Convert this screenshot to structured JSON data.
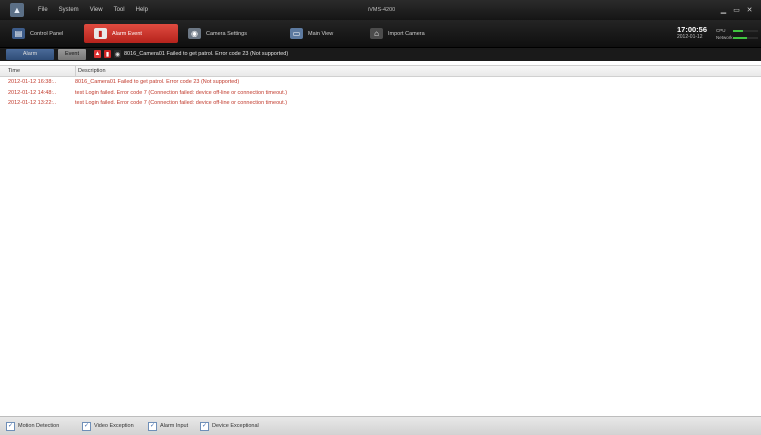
{
  "window": {
    "title": "iVMS-4200",
    "menu": [
      "File",
      "System",
      "View",
      "Tool",
      "Help"
    ],
    "controls": [
      "▁",
      "▭",
      "✕"
    ]
  },
  "toolbar": {
    "tabs": [
      {
        "label": "Control Panel",
        "icon": "control-panel-icon",
        "active": false
      },
      {
        "label": "Alarm Event",
        "icon": "alarm-event-icon",
        "active": true
      },
      {
        "label": "Camera Settings",
        "icon": "camera-settings-icon",
        "active": false
      },
      {
        "label": "Main View",
        "icon": "main-view-icon",
        "active": false
      },
      {
        "label": "Import Camera",
        "icon": "import-camera-icon",
        "active": false
      }
    ],
    "time": "17:00:56",
    "date": "2012-01-12",
    "meters": [
      {
        "label": "CPU",
        "level": 0.4
      },
      {
        "label": "Network",
        "level": 0.55
      }
    ]
  },
  "subbar": {
    "tabs": [
      "Alarm",
      "Event"
    ],
    "active": "Event",
    "message": "8016_Camera01 Failed to get patrol. Error code 23 (Not supported)"
  },
  "table": {
    "headers": [
      "Time",
      "Description"
    ],
    "rows": [
      {
        "time": "2012-01-12 16:38:..",
        "description": "8016_Camera01 Failed to get patrol. Error code 23 (Not supported)"
      },
      {
        "time": "2012-01-12 14:48:..",
        "description": "test Login failed. Error code 7 (Connection failed: device off-line or connection timeout.)"
      },
      {
        "time": "2012-01-12 13:22:..",
        "description": "test Login failed. Error code 7 (Connection failed: device off-line or connection timeout.)"
      }
    ]
  },
  "filters": [
    {
      "label": "Motion Detection",
      "checked": true
    },
    {
      "label": "Video Exception",
      "checked": true
    },
    {
      "label": "Alarm Input",
      "checked": true
    },
    {
      "label": "Device Exceptional",
      "checked": true
    }
  ],
  "colors": {
    "accent_red": "#c0392b",
    "active_tab": "#d83a2f",
    "alarm_tab": "#3d5c8a",
    "meter": "#41c441"
  }
}
